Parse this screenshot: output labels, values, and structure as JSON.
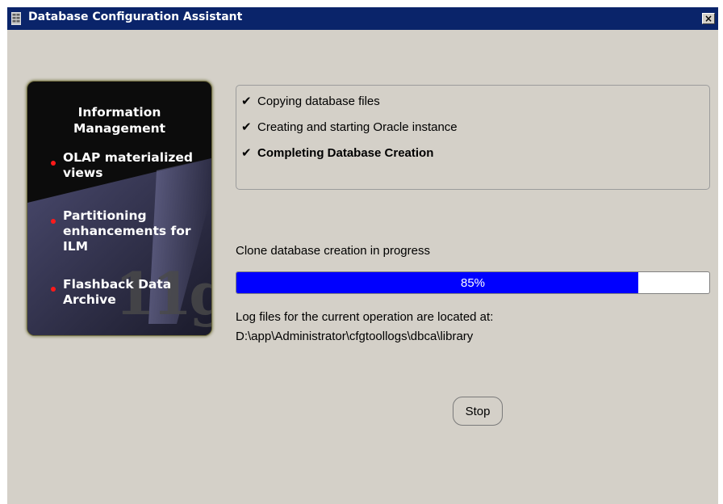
{
  "window": {
    "title": "Database Configuration Assistant",
    "close_label": "×",
    "titlebar_color": "#0a246a"
  },
  "promo": {
    "title_line1": "Information",
    "title_line2": "Management",
    "items": [
      "OLAP materialized views",
      "Partitioning enhancements for ILM",
      "Flashback Data Archive"
    ],
    "logo": "11g",
    "bullet_color": "#ff1a1a"
  },
  "steps": [
    {
      "check": "✔",
      "label": "Copying database files",
      "bold": false
    },
    {
      "check": "✔",
      "label": "Creating and starting Oracle instance",
      "bold": false
    },
    {
      "check": "✔",
      "label": "Completing Database Creation",
      "bold": true
    }
  ],
  "status": {
    "text": "Clone database creation in progress"
  },
  "progress": {
    "value": 0.85,
    "label": "85%",
    "fill_color": "#0000ff"
  },
  "log": {
    "line1": "Log files for the current operation are located at:",
    "line2": "D:\\app\\Administrator\\cfgtoollogs\\dbca\\library"
  },
  "buttons": {
    "stop_label": "Stop"
  }
}
